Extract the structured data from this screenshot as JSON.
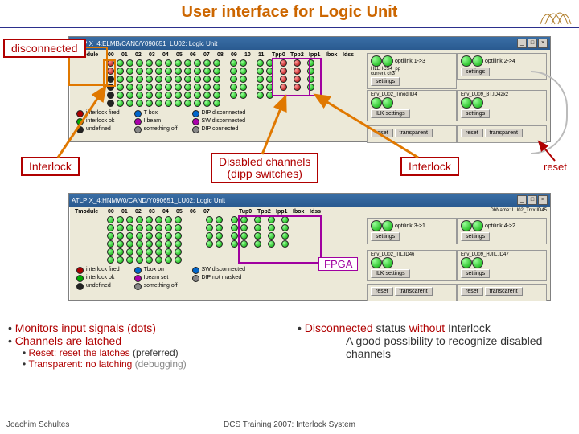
{
  "title": "User interface for Logic Unit",
  "callouts": {
    "disconnected": "disconnected",
    "interlock_left": "Interlock",
    "disabled": "Disabled channels",
    "disabled_sub": "(dipp switches)",
    "interlock_right": "Interlock",
    "reset": "reset",
    "fpga": "FPGA"
  },
  "panel1": {
    "title": "ATLPIX_4:ELMB/CAN0/Y090651_LU02: Logic Unit",
    "headers": [
      "Tmodule",
      "00",
      "01",
      "02",
      "03",
      "04",
      "05",
      "06",
      "07",
      "08",
      "09",
      "10",
      "11",
      "Tpp0",
      "Tpp2",
      "Ipp1",
      "Ibox",
      "Idss"
    ],
    "legend": {
      "col1": [
        {
          "c": "r",
          "t": "interlock fired"
        },
        {
          "c": "g",
          "t": "interlock ok"
        },
        {
          "c": "k",
          "t": "undefined"
        }
      ],
      "col2": [
        {
          "c": "#06c",
          "t": "T box"
        },
        {
          "c": "#a0a",
          "t": "I beam"
        },
        {
          "c": "#888",
          "t": "something off"
        }
      ],
      "col3": [
        {
          "c": "#06c",
          "t": "DIP disconnected"
        },
        {
          "c": "#a0a",
          "t": "SW disconnected"
        },
        {
          "c": "#888",
          "t": "DIP connected"
        }
      ]
    },
    "side": {
      "opto1": "optilink 1->3",
      "opto2": "optilink 2->4",
      "lab1": "HLLHCS4_pp",
      "lab2": "current ch3",
      "btn_settings": "settings",
      "btn_reset": "reset",
      "btn_trans": "transparent",
      "env1": "Env_LU02_Tmod.ID4",
      "env2": "Env_LU09_BT.ID42x2",
      "btn_ilk": "ILK settings",
      "btn_hv": "settings"
    }
  },
  "panel2": {
    "title": "ATLPIX_4:HNMW0/CAND/Y090651_LU02: Logic Unit",
    "headers": [
      "Tmodule",
      "00",
      "01",
      "02",
      "03",
      "04",
      "05",
      "06",
      "07"
    ],
    "extra": [
      "Tup0",
      "Tpp2",
      "Ipp1",
      "Ibox",
      "Idss"
    ],
    "legend": {
      "col1": [
        {
          "c": "r",
          "t": "interlock fired"
        },
        {
          "c": "g",
          "t": "interlock ok"
        },
        {
          "c": "k",
          "t": "undefined"
        }
      ],
      "col2": [
        {
          "c": "#06c",
          "t": "Tbox on"
        },
        {
          "c": "#a0a",
          "t": "Ibeam set"
        },
        {
          "c": "#888",
          "t": "something off"
        }
      ],
      "col3": [
        {
          "c": "#06c",
          "t": "SW disconnected"
        },
        {
          "c": "#888",
          "t": "DIP not masked"
        }
      ]
    },
    "side": {
      "db": "DbName: LU02_Trxx  ID45",
      "opto1": "optilink 3->1",
      "opto2": "optilink 4->2",
      "env1": "Env_LU02_TIL.ID46",
      "env2": "Env_LU09_HJIIL.ID47",
      "btn_settings": "settings",
      "btn_reset": "reset",
      "btn_ilk": "ILK settings",
      "btn_trans": "transcarent"
    }
  },
  "bullets_left": {
    "l1": "Monitors input signals (dots)",
    "l2": "Channels are latched",
    "s1a": "Reset: reset the latches",
    "s1b": "(preferred)",
    "s2a": "Transparent: no latching",
    "s2b": "(debugging)"
  },
  "bullets_right": {
    "l1a": "Disconnected",
    "l1b": "status",
    "l1c": "without",
    "l1d": "Interlock",
    "l2": "A good possibility to recognize disabled channels"
  },
  "footer": {
    "author": "Joachim Schultes",
    "center": "DCS Training 2007: Interlock System"
  }
}
